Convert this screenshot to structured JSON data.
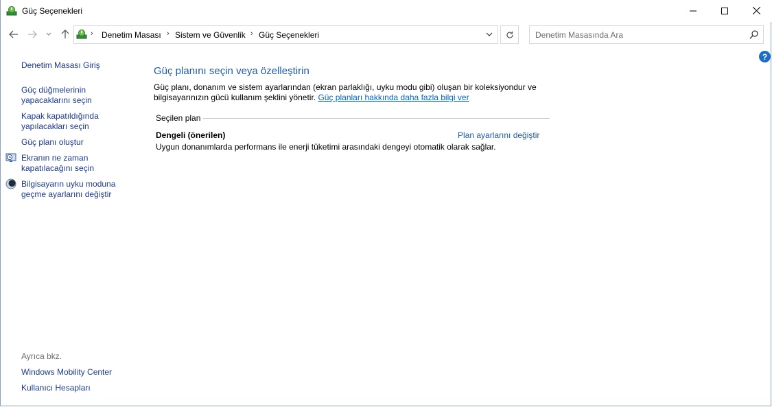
{
  "window": {
    "title": "Güç Seçenekleri"
  },
  "address": {
    "crumbs": [
      "Denetim Masası",
      "Sistem ve Güvenlik",
      "Güç Seçenekleri"
    ]
  },
  "search": {
    "placeholder": "Denetim Masasında Ara"
  },
  "help": {
    "label": "?"
  },
  "sidebar": {
    "home": "Denetim Masası Giriş",
    "items": [
      {
        "label": "Güç düğmelerinin\nyapacaklarını seçin",
        "icon": "none"
      },
      {
        "label": "Kapak kapatıldığında\nyapılacakları seçin",
        "icon": "none"
      },
      {
        "label": "Güç planı oluştur",
        "icon": "none"
      },
      {
        "label": "Ekranın ne zaman\nkapatılacağını seçin",
        "icon": "monitor-clock-icon"
      },
      {
        "label": "Bilgisayarın uyku moduna\ngeçme ayarlarını değiştir",
        "icon": "moon-icon"
      }
    ],
    "see_also_label": "Ayrıca bkz.",
    "see_also": [
      "Windows Mobility Center",
      "Kullanıcı Hesapları"
    ]
  },
  "main": {
    "title": "Güç planını seçin veya özelleştirin",
    "description": "Güç planı, donanım ve sistem ayarlarından (ekran parlaklığı, uyku modu gibi) oluşan bir koleksiyondur ve bilgisayarınızın gücü kullanım şeklini yönetir.",
    "learn_more": "Güç planları hakkında daha fazla bilgi ver",
    "section_label": "Seçilen plan",
    "plan": {
      "name": "Dengeli (önerilen)",
      "change_link": "Plan ayarlarını değiştir",
      "description": "Uygun donanımlarda performans ile enerji tüketimi arasındaki dengeyi otomatik olarak sağlar."
    }
  },
  "colors": {
    "link": "#1e5aa8",
    "heading": "#1e5aa8",
    "help": "#1b6ec2"
  }
}
